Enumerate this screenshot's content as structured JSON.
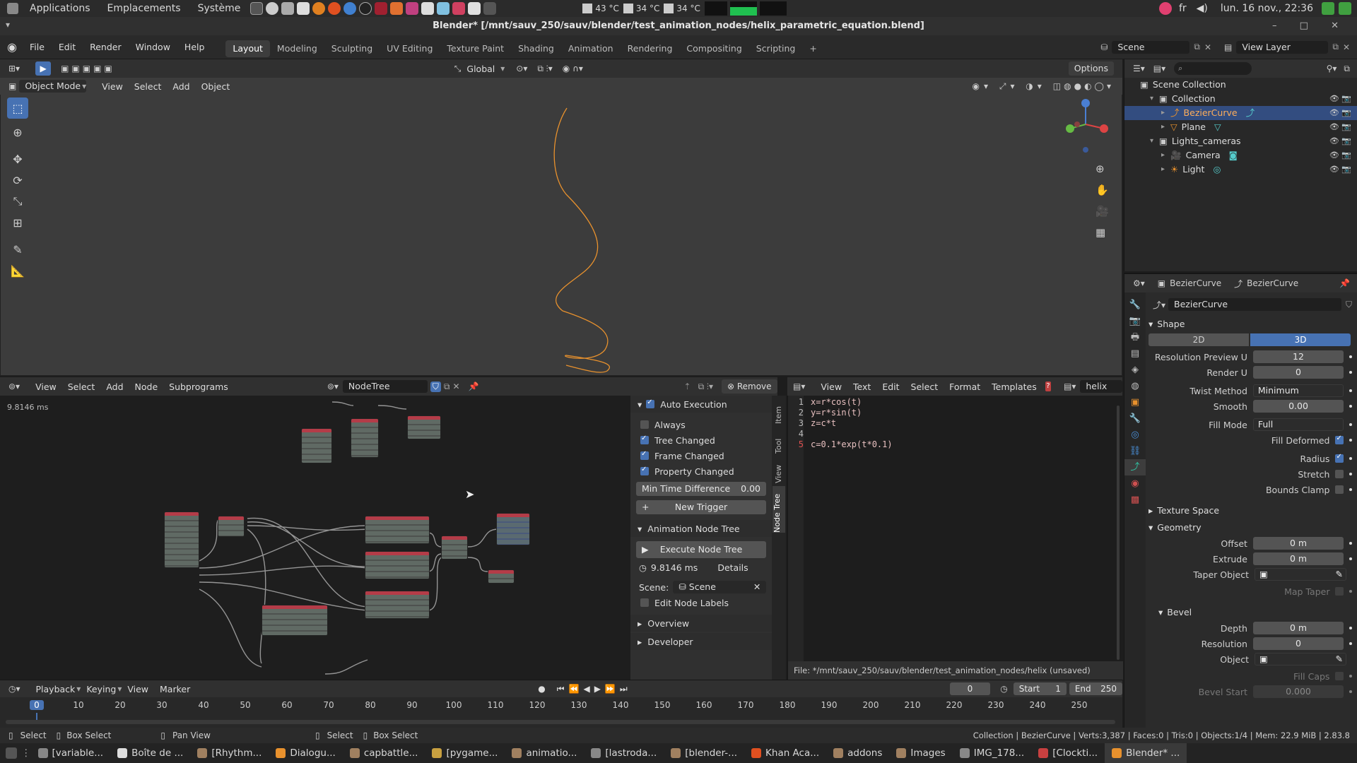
{
  "top_bar": {
    "apps": "Applications",
    "places": "Emplacements",
    "system": "Système",
    "temps": [
      "43 °C",
      "34 °C",
      "34 °C"
    ],
    "lang": "fr",
    "datetime": "lun. 16 nov., 22:36"
  },
  "window": {
    "title": "Blender* [/mnt/sauv_250/sauv/blender/test_animation_nodes/helix_parametric_equation.blend]"
  },
  "header": {
    "menus": [
      "File",
      "Edit",
      "Render",
      "Window",
      "Help"
    ],
    "workspaces": [
      "Layout",
      "Modeling",
      "Sculpting",
      "UV Editing",
      "Texture Paint",
      "Shading",
      "Animation",
      "Rendering",
      "Compositing",
      "Scripting"
    ],
    "active_workspace": "Layout",
    "scene": "Scene",
    "view_layer": "View Layer"
  },
  "viewport": {
    "transform": "Global",
    "options": "Options",
    "mode": "Object Mode",
    "menus": [
      "View",
      "Select",
      "Add",
      "Object"
    ],
    "curve_color": "#e8912d"
  },
  "outliner": {
    "root": "Scene Collection",
    "rows": [
      {
        "name": "Collection",
        "indent": 1
      },
      {
        "name": "BezierCurve",
        "indent": 2,
        "selected": true
      },
      {
        "name": "Plane",
        "indent": 2
      },
      {
        "name": "Lights_cameras",
        "indent": 1
      },
      {
        "name": "Camera",
        "indent": 2
      },
      {
        "name": "Light",
        "indent": 2
      }
    ]
  },
  "properties": {
    "object_name": "BezierCurve",
    "data_name": "BezierCurve",
    "datablock": "BezierCurve",
    "shape": {
      "title": "Shape",
      "btn_2d": "2D",
      "btn_3d": "3D",
      "resolution_preview_u_label": "Resolution Preview U",
      "resolution_preview_u": "12",
      "render_u_label": "Render U",
      "render_u": "0",
      "twist_method_label": "Twist Method",
      "twist_method": "Minimum",
      "smooth_label": "Smooth",
      "smooth": "0.00",
      "fill_mode_label": "Fill Mode",
      "fill_mode": "Full",
      "fill_deformed": "Fill Deformed",
      "radius": "Radius",
      "stretch": "Stretch",
      "bounds_clamp": "Bounds Clamp"
    },
    "texture_space": "Texture Space",
    "geometry": {
      "title": "Geometry",
      "offset_label": "Offset",
      "offset": "0 m",
      "extrude_label": "Extrude",
      "extrude": "0 m",
      "taper_label": "Taper Object",
      "map_taper": "Map Taper"
    },
    "bevel": {
      "title": "Bevel",
      "depth_label": "Depth",
      "depth": "0 m",
      "resolution_label": "Resolution",
      "resolution": "0",
      "object_label": "Object",
      "fill_caps": "Fill Caps",
      "bevel_start_label": "Bevel Start",
      "bevel_start": "0.000"
    }
  },
  "node_editor": {
    "menus": [
      "View",
      "Select",
      "Add",
      "Node",
      "Subprograms"
    ],
    "tree_name": "NodeTree",
    "remove": "Remove",
    "timing": "9.8146 ms",
    "panel": {
      "auto_execution": "Auto Execution",
      "always": "Always",
      "tree_changed": "Tree Changed",
      "frame_changed": "Frame Changed",
      "property_changed": "Property Changed",
      "min_time_label": "Min Time Difference",
      "min_time": "0.00",
      "new_trigger": "New Trigger",
      "animation_node_tree": "Animation Node Tree",
      "execute": "Execute Node Tree",
      "exec_time": "9.8146 ms",
      "details": "Details",
      "scene_label": "Scene:",
      "scene": "Scene",
      "edit_node_labels": "Edit Node Labels",
      "overview": "Overview",
      "developer": "Developer"
    },
    "tabs": [
      "Item",
      "Tool",
      "View",
      "Node Tree"
    ]
  },
  "text_editor": {
    "menus": [
      "View",
      "Text",
      "Edit",
      "Select",
      "Format",
      "Templates"
    ],
    "text_name": "helix",
    "lines": [
      {
        "n": "1",
        "code": "x=r*cos(t)"
      },
      {
        "n": "2",
        "code": "y=r*sin(t)"
      },
      {
        "n": "3",
        "code": "z=c*t"
      },
      {
        "n": "4",
        "code": ""
      },
      {
        "n": "5",
        "code": "c=0.1*exp(t*0.1)"
      }
    ],
    "footer": "File: */mnt/sauv_250/sauv/blender/test_animation_nodes/helix (unsaved)"
  },
  "timeline": {
    "menus": [
      "Playback",
      "Keying",
      "View",
      "Marker"
    ],
    "current_frame": "0",
    "start_label": "Start",
    "start": "1",
    "end_label": "End",
    "end": "250",
    "ticks": [
      "0",
      "10",
      "20",
      "30",
      "40",
      "50",
      "60",
      "70",
      "80",
      "90",
      "100",
      "110",
      "120",
      "130",
      "140",
      "150",
      "160",
      "170",
      "180",
      "190",
      "200",
      "210",
      "220",
      "230",
      "240",
      "250"
    ]
  },
  "status_bar": {
    "select": "Select",
    "box_select": "Box Select",
    "pan_view": "Pan View",
    "select2": "Select",
    "box_select2": "Box Select",
    "stats": "Collection | BezierCurve | Verts:3,387 | Faces:0 | Tris:0 | Objects:1/4 | Mem: 22.9 MiB | 2.83.8"
  },
  "taskbar": [
    {
      "label": "[variable...",
      "color": "#888"
    },
    {
      "label": "Boîte de ...",
      "color": "#ddd"
    },
    {
      "label": "[Rhythm...",
      "color": "#a08060"
    },
    {
      "label": "Dialogu...",
      "color": "#e8912d"
    },
    {
      "label": "capbattle...",
      "color": "#a08060"
    },
    {
      "label": "[pygame...",
      "color": "#c8a040"
    },
    {
      "label": "animatio...",
      "color": "#a08060"
    },
    {
      "label": "[lastroda...",
      "color": "#888"
    },
    {
      "label": "[blender-...",
      "color": "#a08060"
    },
    {
      "label": "Khan Aca...",
      "color": "#e05020"
    },
    {
      "label": "addons",
      "color": "#a08060"
    },
    {
      "label": "Images",
      "color": "#a08060"
    },
    {
      "label": "IMG_178...",
      "color": "#888"
    },
    {
      "label": "[Clockti...",
      "color": "#c84040"
    },
    {
      "label": "Blender* ...",
      "color": "#e8912d"
    }
  ]
}
